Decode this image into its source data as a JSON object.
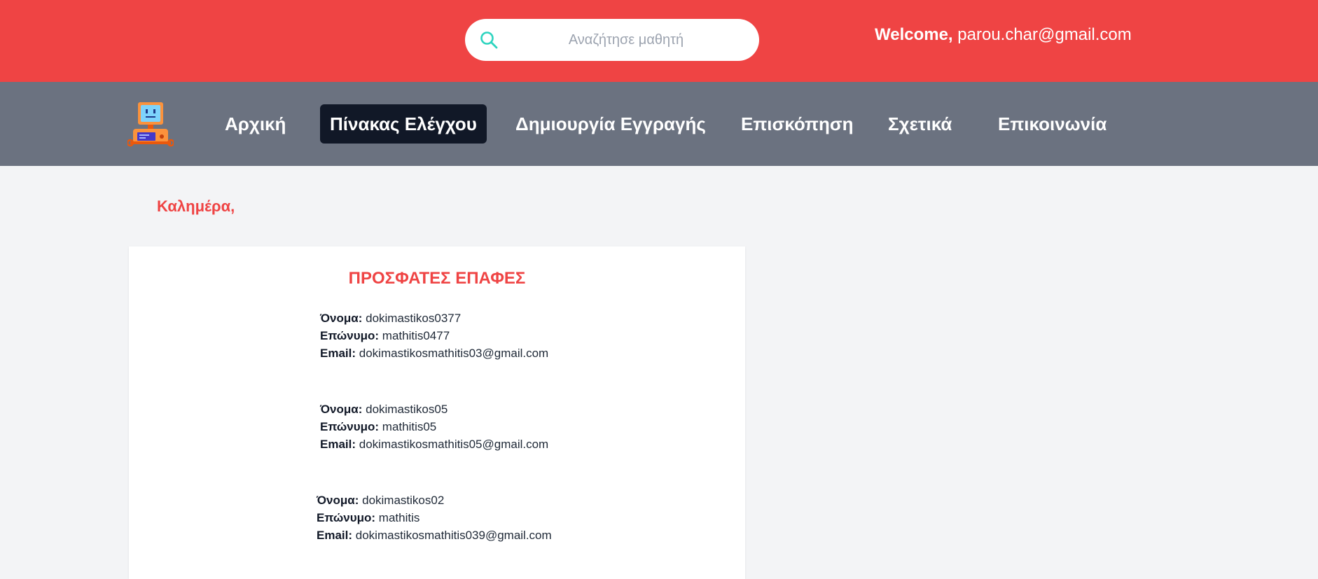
{
  "header": {
    "search": {
      "placeholder": "Αναζήτησε μαθητή",
      "value": "",
      "icon": "search-icon"
    },
    "welcome_label": "Welcome,",
    "user_email": "parou.char@gmail.com",
    "colors": {
      "background": "#ef4444",
      "search_icon": "#2dd4bf"
    }
  },
  "nav": {
    "logo": "computer-mascot-logo",
    "items": [
      {
        "label": "Αρχική",
        "active": false
      },
      {
        "label": "Πίνακας Ελέγχου",
        "active": true
      },
      {
        "label": "Δημιουργία Εγγραγής",
        "active": false
      },
      {
        "label": "Επισκόπηση",
        "active": false
      },
      {
        "label": "Σχετικά",
        "active": false
      },
      {
        "label": "Επικοινωνία",
        "active": false
      }
    ],
    "colors": {
      "background": "#6b7280",
      "active_background": "#111827"
    }
  },
  "main": {
    "greeting": "Καλημέρα,",
    "recent_contacts": {
      "title": "ΠΡΟΣΦΑΤΕΣ ΕΠΑΦΕΣ",
      "labels": {
        "first_name": "Όνομα:",
        "last_name": "Επώνυμο:",
        "email": "Email:"
      },
      "contacts": [
        {
          "first_name": "dokimastikos0377",
          "last_name": "mathitis0477",
          "email": "dokimastikosmathitis03@gmail.com"
        },
        {
          "first_name": "dokimastikos05",
          "last_name": "mathitis05",
          "email": "dokimastikosmathitis05@gmail.com"
        },
        {
          "first_name": "dokimastikos02",
          "last_name": "mathitis",
          "email": "dokimastikosmathitis039@gmail.com"
        }
      ]
    }
  }
}
